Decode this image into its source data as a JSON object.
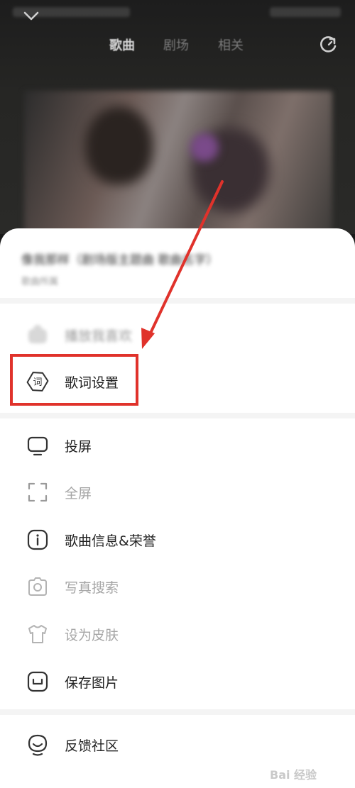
{
  "nav": {
    "tabs": [
      {
        "label": "歌曲",
        "active": true
      },
      {
        "label": "剧场",
        "active": false
      },
      {
        "label": "相关",
        "active": false
      }
    ]
  },
  "song": {
    "title": "像我那样（剧场版主题曲 歌曲名字）",
    "subtitle": "歌曲所属"
  },
  "menu": {
    "blurred_item": "播放我喜欢",
    "lyrics_settings": "歌词设置",
    "lyrics_icon_char": "词",
    "cast": "投屏",
    "fullscreen": "全屏",
    "song_info": "歌曲信息&荣誉",
    "photo_search": "写真搜索",
    "set_skin": "设为皮肤",
    "save_image": "保存图片",
    "feedback": "反馈社区"
  },
  "watermark": {
    "text": "Bai 经验"
  },
  "colors": {
    "highlight": "#e0322b",
    "arrow": "#e0322b",
    "dim_text": "#a6a6a6"
  },
  "icons": [
    "chevron-down-icon",
    "refresh-icon",
    "lyrics-icon",
    "cast-icon",
    "fullscreen-icon",
    "info-icon",
    "camera-icon",
    "tshirt-icon",
    "save-image-icon",
    "feedback-icon"
  ]
}
